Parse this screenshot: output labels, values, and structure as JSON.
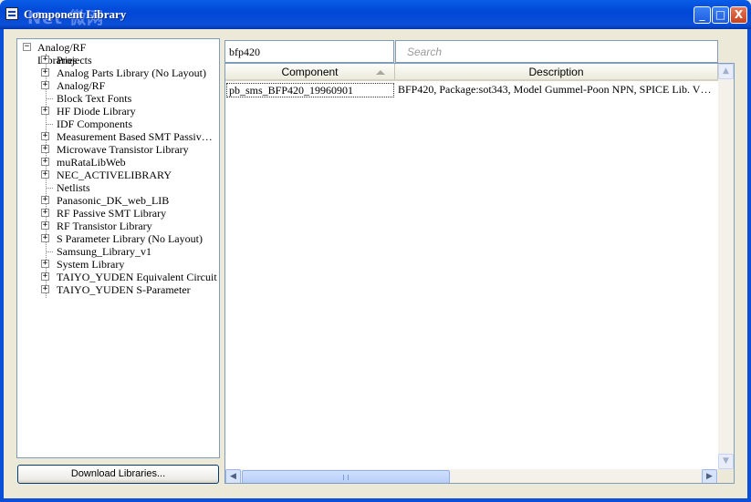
{
  "window": {
    "title": "Component Library",
    "watermark": "Net 微网",
    "buttons": {
      "minimize": "_",
      "maximize": "□",
      "close": "X"
    }
  },
  "tree": {
    "root": {
      "label": "Analog/RF Libraries",
      "expander": "−"
    },
    "items": [
      {
        "label": "Projects",
        "has_children": true
      },
      {
        "label": "Analog Parts Library (No Layout)",
        "has_children": true
      },
      {
        "label": "Analog/RF",
        "has_children": true
      },
      {
        "label": "Block Text Fonts",
        "has_children": false
      },
      {
        "label": "HF Diode Library",
        "has_children": true
      },
      {
        "label": "IDF Components",
        "has_children": false
      },
      {
        "label": "Measurement Based SMT Passiv…",
        "has_children": true
      },
      {
        "label": "Microwave Transistor Library",
        "has_children": true
      },
      {
        "label": "muRataLibWeb",
        "has_children": true
      },
      {
        "label": "NEC_ACTIVELIBRARY",
        "has_children": true
      },
      {
        "label": "Netlists",
        "has_children": false
      },
      {
        "label": "Panasonic_DK_web_LIB",
        "has_children": true
      },
      {
        "label": "RF Passive SMT Library",
        "has_children": true
      },
      {
        "label": "RF Transistor Library",
        "has_children": true
      },
      {
        "label": "S Parameter Library (No Layout)",
        "has_children": true
      },
      {
        "label": "Samsung_Library_v1",
        "has_children": false
      },
      {
        "label": "System Library",
        "has_children": true
      },
      {
        "label": "TAIYO_YUDEN Equivalent Circuit",
        "has_children": true
      },
      {
        "label": "TAIYO_YUDEN S-Parameter",
        "has_children": true
      }
    ],
    "expander_plus": "+"
  },
  "download_button": "Download Libraries...",
  "filter": {
    "value": "bfp420"
  },
  "search": {
    "placeholder": "Search"
  },
  "table": {
    "columns": [
      "Component",
      "Description"
    ],
    "rows": [
      [
        "pb_sms_BFP420_19960901",
        "BFP420, Package:sot343, Model Gummel-Poon NPN, SPICE Lib. V…"
      ]
    ]
  },
  "scrollbar": {
    "up": "▲",
    "down": "▼",
    "left": "◀",
    "right": "▶"
  }
}
